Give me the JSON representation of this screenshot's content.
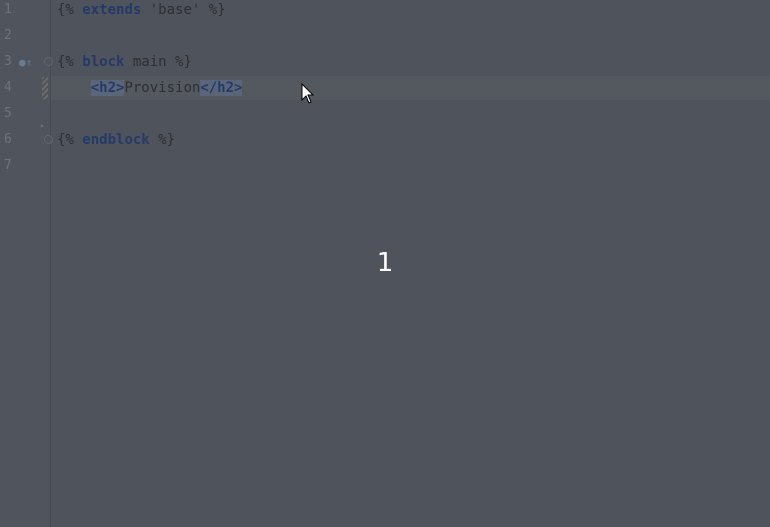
{
  "gutter": {
    "line_numbers": [
      "1",
      "2",
      "3",
      "4",
      "5",
      "6",
      "7"
    ]
  },
  "code": {
    "line1": {
      "open": "{%",
      "kw": "extends",
      "str": "'base'",
      "close": "%}"
    },
    "line3": {
      "open": "{%",
      "kw": "block",
      "name": "main",
      "close": "%}"
    },
    "line4": {
      "indent": "    ",
      "tag_open": "<h2>",
      "text": "Provision",
      "tag_close": "</h2>"
    },
    "line6": {
      "open": "{%",
      "kw": "endblock",
      "close": "%}"
    }
  },
  "overlay": {
    "frame_number": "1"
  },
  "icons": {
    "override_marker": "override-marker-icon",
    "fold_markers": "fold-icon",
    "mouse_pointer": "mouse-pointer-icon"
  },
  "colors": {
    "background": "#4f535b",
    "keyword": "#243a6b",
    "tag_highlight": "#5a6677"
  }
}
